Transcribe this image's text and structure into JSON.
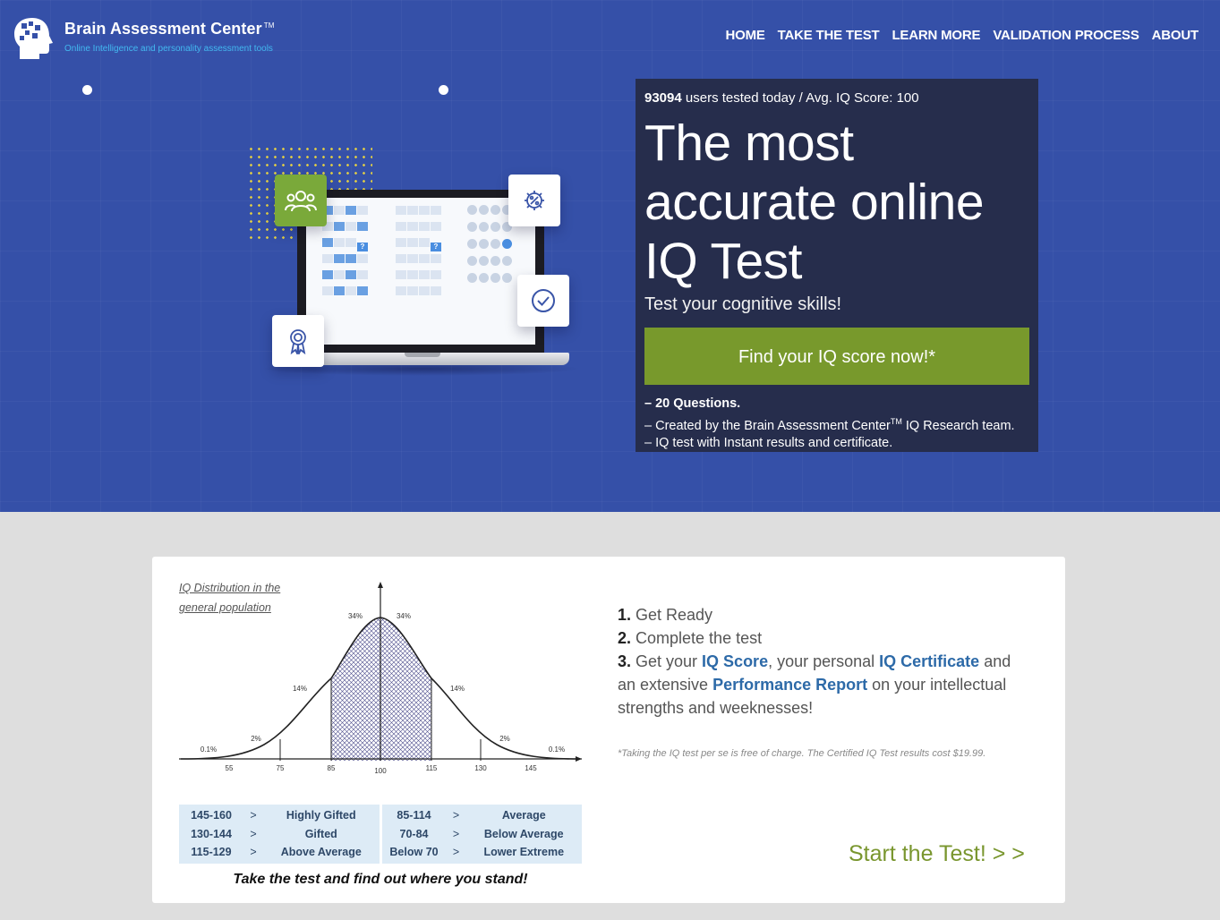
{
  "brand": {
    "name": "Brain Assessment Center",
    "tm": "TM",
    "tagline": "Online Intelligence and personality assessment tools"
  },
  "nav": [
    "HOME",
    "TAKE THE TEST",
    "LEARN MORE",
    "VALIDATION PROCESS",
    "ABOUT"
  ],
  "hero": {
    "users_count": "93094",
    "stats_rest": " users tested today / Avg. IQ Score: 100",
    "headline": "The most accurate online IQ Test",
    "subline": "Test your cognitive skills!",
    "cta": "Find your IQ score now!*",
    "feature_1": "– 20 Questions.",
    "feature_2a": "– Created by the Brain Assessment Center",
    "feature_2tm": "TM",
    "feature_2b": " IQ Research team.",
    "feature_3": "– IQ test with Instant results and certificate."
  },
  "distribution": {
    "title": "IQ Distribution in the general population",
    "percent_labels": [
      "0.1%",
      "2%",
      "14%",
      "34%",
      "34%",
      "14%",
      "2%",
      "0.1%"
    ],
    "axis_ticks": [
      "55",
      "75",
      "85",
      "100",
      "115",
      "130",
      "145"
    ],
    "table_left": [
      [
        "145-160",
        ">",
        "Highly Gifted"
      ],
      [
        "130-144",
        ">",
        "Gifted"
      ],
      [
        "115-129",
        ">",
        "Above Average"
      ]
    ],
    "table_right": [
      [
        "85-114",
        ">",
        "Average"
      ],
      [
        "70-84",
        ">",
        "Below Average"
      ],
      [
        "Below 70",
        ">",
        "Lower Extreme"
      ]
    ],
    "tagline": "Take the test and find out where you stand!"
  },
  "steps": {
    "s1_num": "1.",
    "s1": " Get Ready",
    "s2_num": "2.",
    "s2": " Complete the test",
    "s3_num": "3.",
    "s3a": " Get your ",
    "s3_iq": "IQ Score",
    "s3b": ", your personal ",
    "s3_cert": "IQ Certificate",
    "s3c": " and an extensive ",
    "s3_report": "Performance Report",
    "s3d": " on your intellectual strengths and weeknesses!"
  },
  "note": "*Taking the IQ test per se is free of charge. The Certified IQ Test results cost $19.99.",
  "start": "Start the Test! > >",
  "colors": {
    "hero_bg": "#3550a8",
    "panel_bg": "#262d4c",
    "cta_green": "#78992c",
    "link_blue": "#2d6aa8"
  }
}
